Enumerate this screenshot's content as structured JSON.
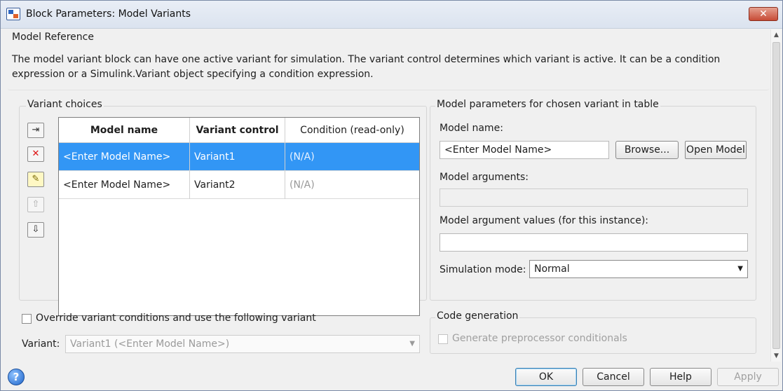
{
  "window": {
    "title": "Block Parameters: Model Variants",
    "close_label": "✕"
  },
  "model_reference": {
    "title": "Model Reference",
    "description_line1": "The model variant block can have one active variant for simulation. The variant control determines which variant is active. It can be a condition",
    "description_line2": "expression or a Simulink.Variant object specifying a condition expression."
  },
  "variant_choices": {
    "title": "Variant choices",
    "toolbar_buttons": [
      {
        "name": "add-choice",
        "icon": "add-row-icon",
        "glyph": "⇥"
      },
      {
        "name": "delete-choice",
        "icon": "delete-icon",
        "glyph": "✕"
      },
      {
        "name": "edit-choice",
        "icon": "edit-icon",
        "glyph": "✎"
      },
      {
        "name": "move-up",
        "icon": "arrow-up-icon",
        "glyph": "⇧",
        "disabled": true
      },
      {
        "name": "move-down",
        "icon": "arrow-down-icon",
        "glyph": "⇩"
      }
    ],
    "columns": [
      "Model name",
      "Variant control",
      "Condition (read-only)"
    ],
    "rows": [
      {
        "model_name": "<Enter Model Name>",
        "variant_control": "Variant1",
        "condition": "(N/A)",
        "selected": true
      },
      {
        "model_name": "<Enter Model Name>",
        "variant_control": "Variant2",
        "condition": "(N/A)",
        "selected": false
      }
    ]
  },
  "model_params": {
    "title": "Model parameters for chosen variant in table",
    "model_name_label": "Model name:",
    "model_name_value": "<Enter Model Name>",
    "browse_label": "Browse...",
    "open_model_label": "Open Model",
    "model_arguments_label": "Model arguments:",
    "model_arguments_value": "",
    "model_argument_values_label": "Model argument values (for this instance):",
    "model_argument_values_value": "",
    "simulation_mode_label": "Simulation mode:",
    "simulation_mode_value": "Normal"
  },
  "override": {
    "checkbox_label": "Override variant conditions and use the following variant",
    "checked": false,
    "variant_label": "Variant:",
    "variant_value": "Variant1 (<Enter Model Name>)"
  },
  "code_generation": {
    "title": "Code generation",
    "checkbox_label": "Generate preprocessor conditionals",
    "checked": false
  },
  "footer": {
    "help_icon": "?",
    "ok_label": "OK",
    "cancel_label": "Cancel",
    "help_label": "Help",
    "apply_label": "Apply"
  },
  "colors": {
    "selection": "#3296f5",
    "accent_close": "#c74b36"
  }
}
